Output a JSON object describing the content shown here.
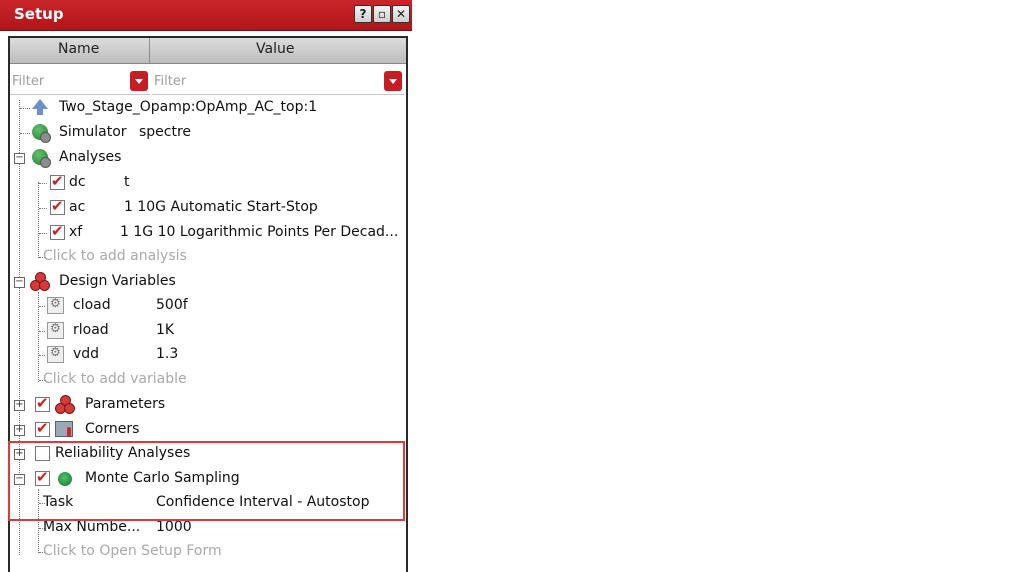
{
  "window": {
    "title": "Setup",
    "buttons": [
      "?",
      "▫",
      "✕"
    ]
  },
  "columns": {
    "name": "Name",
    "value": "Value"
  },
  "filters": {
    "name_placeholder": "Filter",
    "value_placeholder": "Filter"
  },
  "tree": {
    "testbench": "Two_Stage_Opamp:OpAmp_AC_top:1",
    "simulator": {
      "label": "Simulator",
      "value": "spectre"
    },
    "analyses": {
      "label": "Analyses",
      "items": [
        {
          "name": "dc",
          "value": "t"
        },
        {
          "name": "ac",
          "value": "1 10G Automatic Start-Stop"
        },
        {
          "name": "xf",
          "value": "1 1G 10 Logarithmic Points Per Decad..."
        }
      ],
      "add_hint": "Click to add analysis"
    },
    "design_variables": {
      "label": "Design Variables",
      "items": [
        {
          "name": "cload",
          "value": "500f"
        },
        {
          "name": "rload",
          "value": "1K"
        },
        {
          "name": "vdd",
          "value": "1.3"
        }
      ],
      "add_hint": "Click to add variable"
    },
    "parameters": {
      "label": "Parameters"
    },
    "corners": {
      "label": "Corners"
    },
    "reliability": {
      "label": "Reliability Analyses"
    },
    "monte_carlo": {
      "label": "Monte Carlo Sampling",
      "task": {
        "name": "Task",
        "value": "Confidence Interval - Autostop"
      },
      "max_number": {
        "name": "Max Numbe...",
        "value": "1000"
      },
      "open_hint": "Click to Open Setup Form"
    }
  },
  "colors": {
    "accent": "#b01619",
    "highlight": "#e0393c"
  }
}
